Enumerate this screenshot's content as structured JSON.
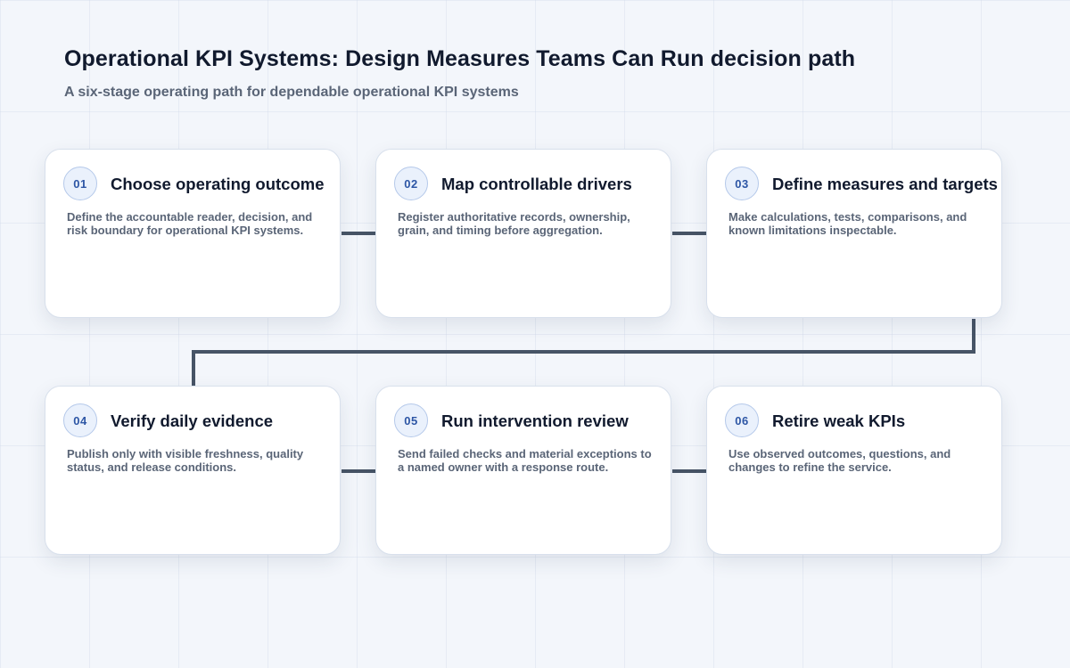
{
  "page": {
    "title": "Operational KPI Systems: Design Measures Teams Can Run decision path",
    "subtitle": "A six-stage operating path for dependable operational KPI systems"
  },
  "stages": [
    {
      "number": "01",
      "title": "Choose operating outcome",
      "description": "Define the accountable reader, decision, and risk boundary for operational KPI systems."
    },
    {
      "number": "02",
      "title": "Map controllable drivers",
      "description": "Register authoritative records, ownership, grain, and timing before aggregation."
    },
    {
      "number": "03",
      "title": "Define measures and targets",
      "description": "Make calculations, tests, comparisons, and known limitations inspectable."
    },
    {
      "number": "04",
      "title": "Verify daily evidence",
      "description": "Publish only with visible freshness, quality status, and release conditions."
    },
    {
      "number": "05",
      "title": "Run intervention review",
      "description": "Send failed checks and material exceptions to a named owner with a response route."
    },
    {
      "number": "06",
      "title": "Retire weak KPIs",
      "description": "Use observed outcomes, questions, and changes to refine the service."
    }
  ],
  "colors": {
    "connector": "#475466",
    "badge_text": "#2d56a5",
    "title_text": "#111a2e",
    "body_text": "#5a6577"
  }
}
